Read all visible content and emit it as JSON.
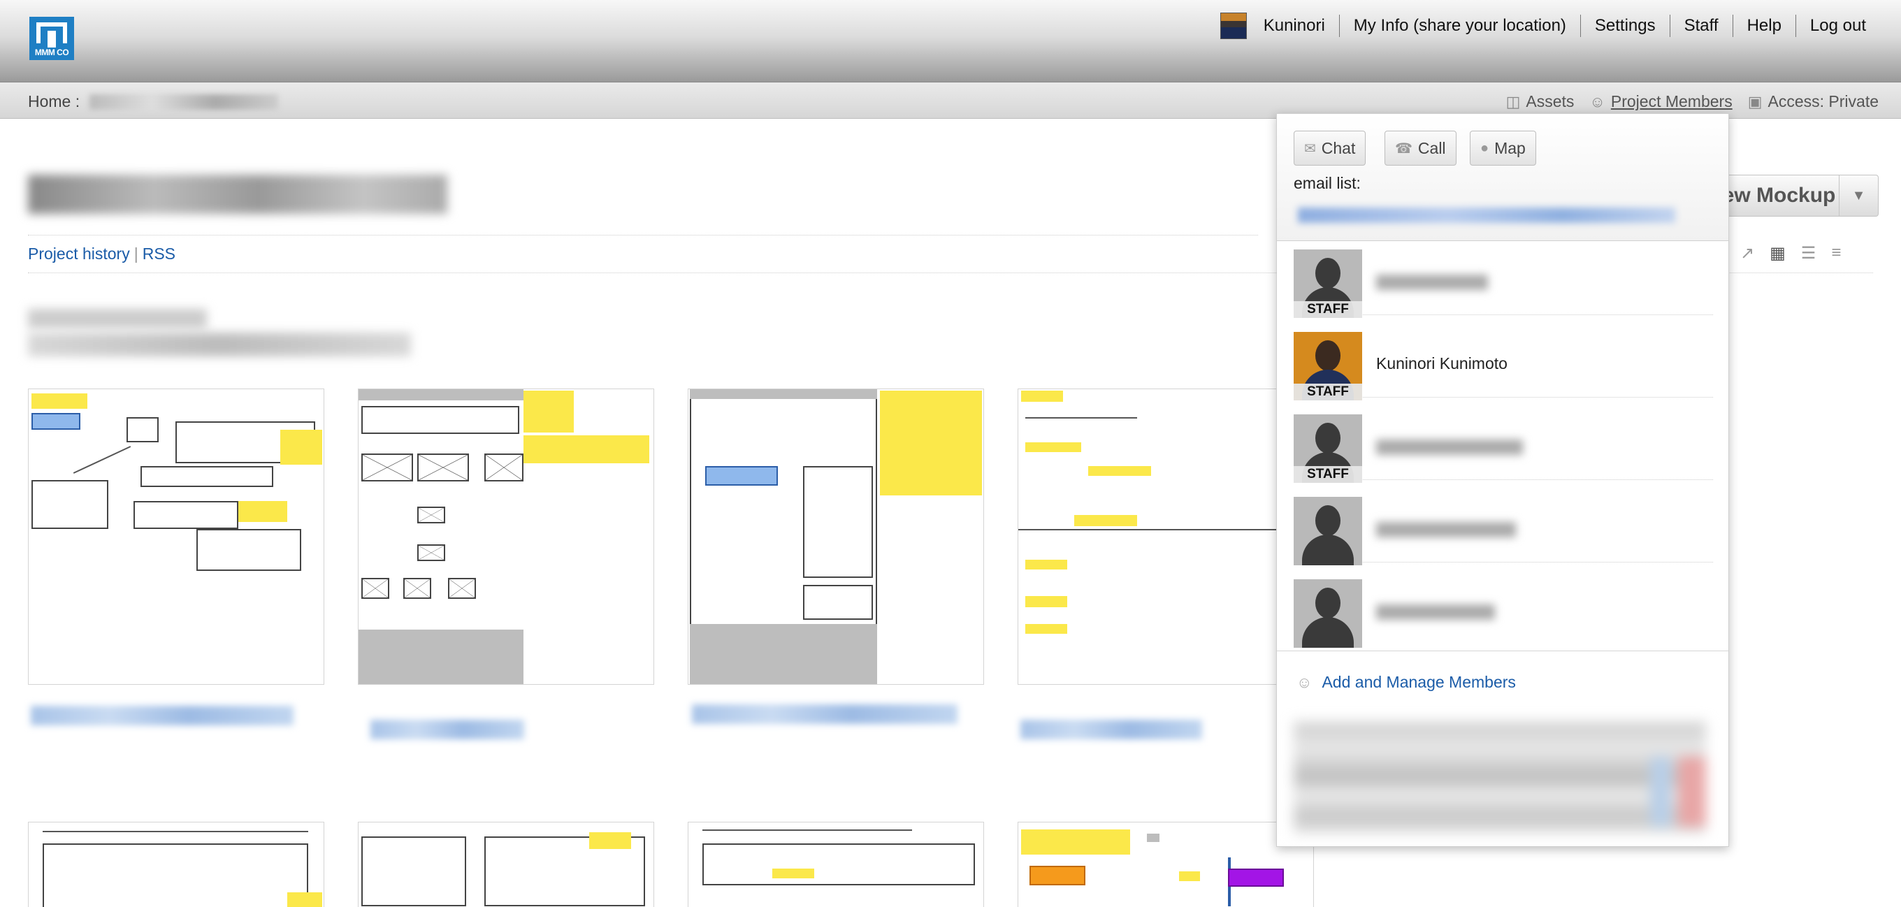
{
  "app": {
    "logo_text": "MMM CO"
  },
  "topnav": {
    "user": "Kuninori",
    "my_info": "My Info (share your location)",
    "settings": "Settings",
    "staff": "Staff",
    "help": "Help",
    "logout": "Log out"
  },
  "breadcrumb": {
    "home": "Home :"
  },
  "subnav": {
    "assets": "Assets",
    "project_members": "Project Members",
    "access": "Access: Private"
  },
  "project": {
    "history_link": "Project history",
    "separator": "|",
    "rss_link": "RSS"
  },
  "toolbar": {
    "new_mockup_label": "New Mockup",
    "view_icons": [
      "export-icon",
      "grid-view-icon",
      "list-view-icon",
      "compact-list-icon"
    ]
  },
  "popup": {
    "chat_label": "Chat",
    "call_label": "Call",
    "map_label": "Map",
    "email_label": "email list:",
    "members": [
      {
        "name": "",
        "staff": "STAFF",
        "photo": "placeholder"
      },
      {
        "name": "Kuninori Kunimoto",
        "staff": "STAFF",
        "photo": "photo"
      },
      {
        "name": "",
        "staff": "STAFF",
        "photo": "placeholder"
      },
      {
        "name": "",
        "staff": "",
        "photo": "placeholder"
      },
      {
        "name": "",
        "staff": "",
        "photo": "placeholder"
      }
    ],
    "add_members": "Add and Manage Members"
  },
  "colors": {
    "link": "#1b5ca8",
    "sticky": "#fbe84a",
    "logo": "#1f7fc4"
  }
}
